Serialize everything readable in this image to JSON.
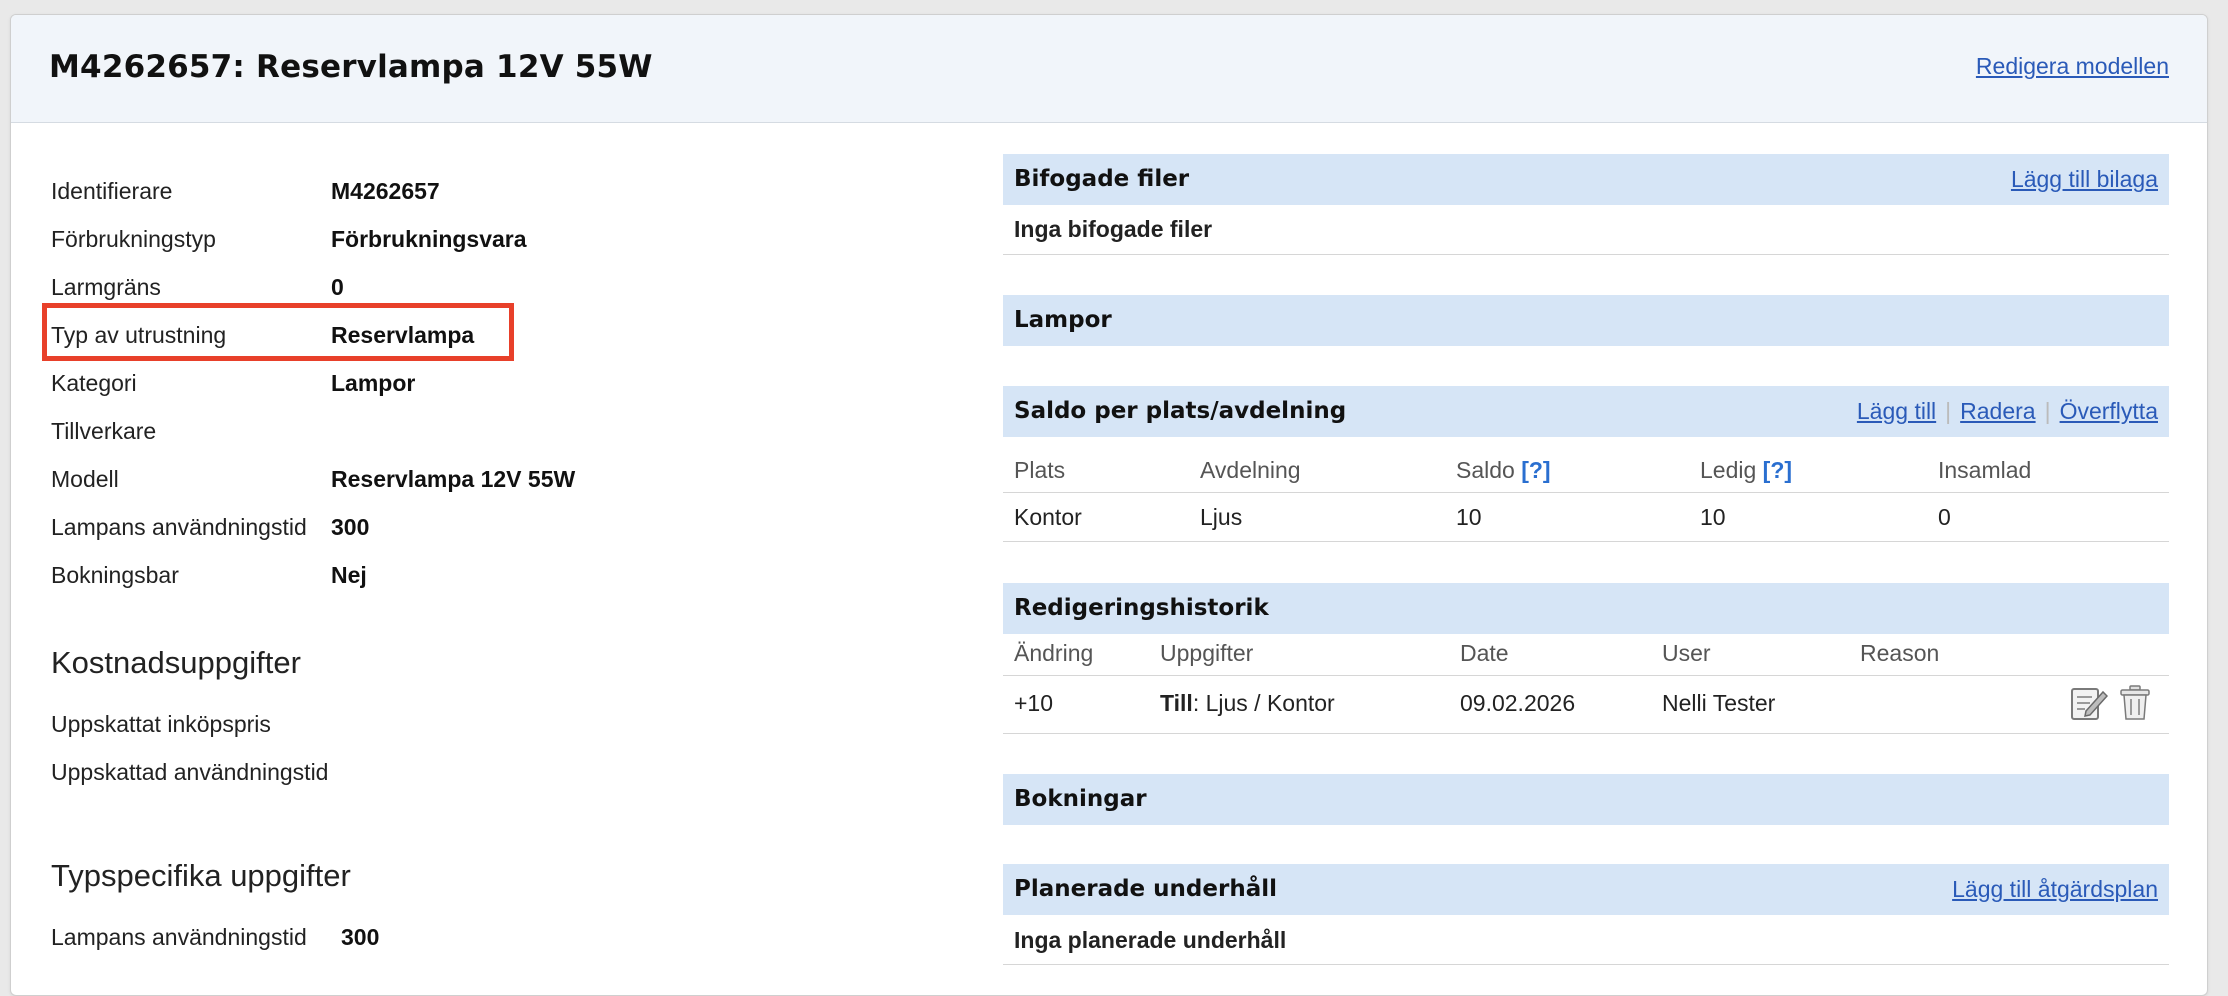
{
  "header": {
    "title": "M4262657: Reservlampa 12V 55W",
    "edit_link": "Redigera modellen"
  },
  "properties": [
    {
      "label": "Identifierare",
      "value": "M4262657"
    },
    {
      "label": "Förbrukningstyp",
      "value": "Förbrukningsvara"
    },
    {
      "label": "Larmgräns",
      "value": "0"
    },
    {
      "label": "Typ av utrustning",
      "value": "Reservlampa"
    },
    {
      "label": "Kategori",
      "value": "Lampor"
    },
    {
      "label": "Tillverkare",
      "value": ""
    },
    {
      "label": "Modell",
      "value": "Reservlampa 12V 55W"
    },
    {
      "label": "Lampans användningstid",
      "value": "300"
    },
    {
      "label": "Bokningsbar",
      "value": "Nej"
    }
  ],
  "cost": {
    "title": "Kostnadsuppgifter",
    "rows": [
      "Uppskattat inköpspris",
      "Uppskattad användningstid"
    ]
  },
  "type_specific": {
    "title": "Typspecifika uppgifter",
    "label": "Lampans användningstid",
    "value": "300"
  },
  "attachments": {
    "title": "Bifogade filer",
    "add_link": "Lägg till bilaga",
    "empty": "Inga bifogade filer"
  },
  "lamps": {
    "title": "Lampor"
  },
  "stock": {
    "title": "Saldo per plats/avdelning",
    "links": {
      "add": "Lägg till",
      "delete": "Radera",
      "transfer": "Överflytta"
    },
    "columns": {
      "place": "Plats",
      "dept": "Avdelning",
      "balance": "Saldo",
      "free": "Ledig",
      "collected": "Insamlad",
      "help": "[?]"
    },
    "rows": [
      {
        "place": "Kontor",
        "dept": "Ljus",
        "balance": "10",
        "free": "10",
        "collected": "0"
      }
    ]
  },
  "history": {
    "title": "Redigeringshistorik",
    "columns": {
      "change": "Ändring",
      "details": "Uppgifter",
      "date": "Date",
      "user": "User",
      "reason": "Reason"
    },
    "rows": [
      {
        "change": "+10",
        "details_bold": "Till",
        "details_rest": ": Ljus / Kontor",
        "date": "09.02.2026",
        "user": "Nelli Tester",
        "reason": ""
      }
    ]
  },
  "bookings": {
    "title": "Bokningar"
  },
  "maintenance": {
    "title": "Planerade underhåll",
    "add_link": "Lägg till åtgärdsplan",
    "empty": "Inga planerade underhåll"
  }
}
